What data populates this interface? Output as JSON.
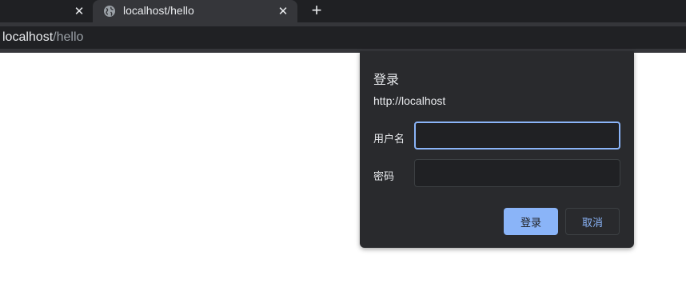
{
  "browser": {
    "tabs": [
      {
        "title": ""
      },
      {
        "title": "localhost/hello"
      }
    ],
    "close_glyph": "✕",
    "new_tab_glyph": "+",
    "address": {
      "host": "localhost",
      "path": "/hello"
    }
  },
  "dialog": {
    "title": "登录",
    "origin": "http://localhost",
    "username_label": "用户名",
    "username_value": "",
    "password_label": "密码",
    "password_value": "",
    "login_button": "登录",
    "cancel_button": "取消"
  },
  "colors": {
    "accent": "#8ab4f8",
    "dialog_bg": "#292a2d",
    "tabbar_bg": "#1f2023"
  }
}
